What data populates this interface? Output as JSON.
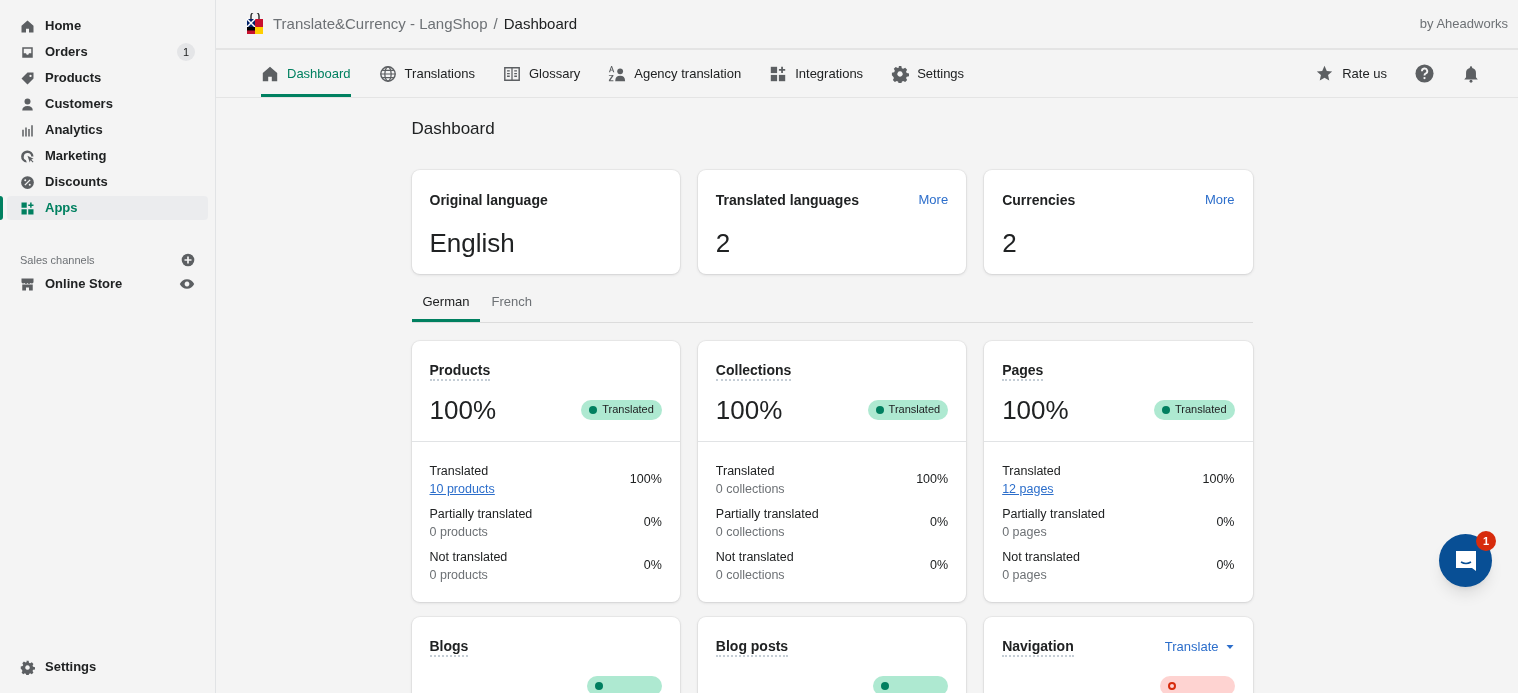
{
  "sidebar": {
    "items": [
      {
        "label": "Home",
        "selected": false
      },
      {
        "label": "Orders",
        "selected": false,
        "badge": "1"
      },
      {
        "label": "Products",
        "selected": false
      },
      {
        "label": "Customers",
        "selected": false
      },
      {
        "label": "Analytics",
        "selected": false
      },
      {
        "label": "Marketing",
        "selected": false
      },
      {
        "label": "Discounts",
        "selected": false
      },
      {
        "label": "Apps",
        "selected": true
      }
    ],
    "sales_channels": {
      "title": "Sales channels",
      "items": [
        {
          "label": "Online Store"
        }
      ]
    },
    "footer": {
      "label": "Settings"
    }
  },
  "header": {
    "app_title": "Translate&Currency - LangShop",
    "separator": "/",
    "page": "Dashboard",
    "vendor": "by Aheadworks"
  },
  "nav": {
    "tabs": [
      {
        "label": "Dashboard",
        "selected": true
      },
      {
        "label": "Translations",
        "selected": false
      },
      {
        "label": "Glossary",
        "selected": false
      },
      {
        "label": "Agency translation",
        "selected": false
      },
      {
        "label": "Integrations",
        "selected": false
      },
      {
        "label": "Settings",
        "selected": false
      }
    ],
    "rate": "Rate us"
  },
  "page_title": "Dashboard",
  "summary_cards": [
    {
      "title": "Original language",
      "value": "English"
    },
    {
      "title": "Translated languages",
      "value": "2",
      "link": "More"
    },
    {
      "title": "Currencies",
      "value": "2",
      "link": "More"
    }
  ],
  "language_tabs": [
    {
      "label": "German",
      "selected": true
    },
    {
      "label": "French",
      "selected": false
    }
  ],
  "resource_cards": [
    {
      "title": "Products",
      "percent": "100%",
      "status": {
        "label": "Translated",
        "kind": "translated"
      },
      "rows": [
        {
          "label": "Translated",
          "count": "10 products",
          "count_is_link": true,
          "percent": "100%"
        },
        {
          "label": "Partially translated",
          "count": "0 products",
          "count_is_link": false,
          "percent": "0%"
        },
        {
          "label": "Not translated",
          "count": "0 products",
          "count_is_link": false,
          "percent": "0%"
        }
      ]
    },
    {
      "title": "Collections",
      "percent": "100%",
      "status": {
        "label": "Translated",
        "kind": "translated"
      },
      "rows": [
        {
          "label": "Translated",
          "count": "0 collections",
          "count_is_link": false,
          "percent": "100%"
        },
        {
          "label": "Partially translated",
          "count": "0 collections",
          "count_is_link": false,
          "percent": "0%"
        },
        {
          "label": "Not translated",
          "count": "0 collections",
          "count_is_link": false,
          "percent": "0%"
        }
      ]
    },
    {
      "title": "Pages",
      "percent": "100%",
      "status": {
        "label": "Translated",
        "kind": "translated"
      },
      "rows": [
        {
          "label": "Translated",
          "count": "12 pages",
          "count_is_link": true,
          "percent": "100%"
        },
        {
          "label": "Partially translated",
          "count": "0 pages",
          "count_is_link": false,
          "percent": "0%"
        },
        {
          "label": "Not translated",
          "count": "0 pages",
          "count_is_link": false,
          "percent": "0%"
        }
      ]
    },
    {
      "title": "Blogs",
      "status": {
        "kind": "translated"
      }
    },
    {
      "title": "Blog posts",
      "status": {
        "kind": "translated"
      }
    },
    {
      "title": "Navigation",
      "status": {
        "kind": "incomplete"
      },
      "action": "Translate"
    }
  ],
  "chat": {
    "badge": "1"
  }
}
